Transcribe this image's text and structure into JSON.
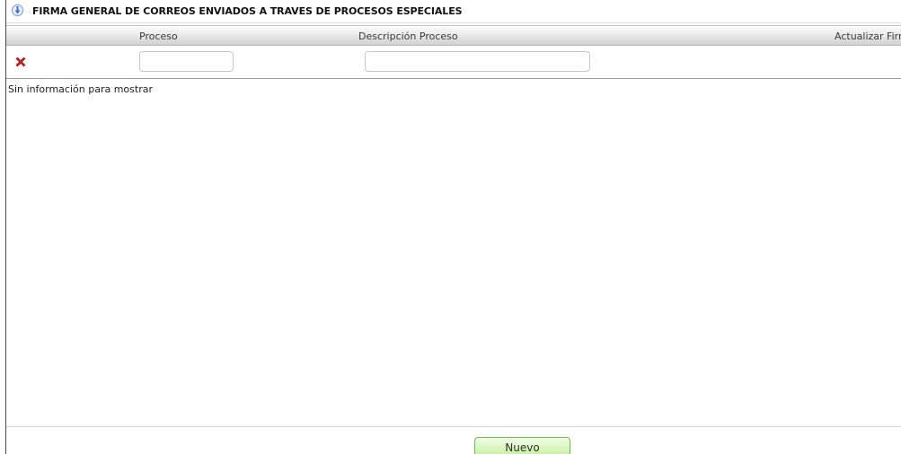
{
  "title": {
    "icon": "info-download-icon",
    "text": "FIRMA GENERAL DE CORREOS ENVIADOS A TRAVES DE PROCESOS ESPECIALES"
  },
  "grid": {
    "columns": [
      {
        "label": "Proceso"
      },
      {
        "label": "Descripción Proceso"
      },
      {
        "label": "Actualizar Firm"
      }
    ],
    "filters": {
      "clear_icon": "red-x-icon",
      "proceso_value": "",
      "descripcion_value": ""
    },
    "empty_message": "Sin información para mostrar"
  },
  "footer": {
    "new_button_label": "Nuevo"
  },
  "colors": {
    "accent_blue": "#3a6fd0",
    "clear_red": "#c8201c",
    "button_green": "#c2ec9c"
  }
}
